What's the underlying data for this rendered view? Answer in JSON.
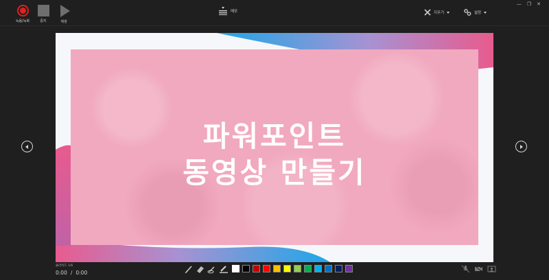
{
  "toolbar": {
    "record_label": "녹음/녹화",
    "stop_label": "중지",
    "replay_label": "재생",
    "memo_label": "메모",
    "clear_label": "지우기",
    "settings_label": "설정"
  },
  "window_controls": {
    "minimize": "—",
    "restore": "❐",
    "close": "✕"
  },
  "slide": {
    "title_line1": "파워포인트",
    "title_line2": "동영상 만들기"
  },
  "footer": {
    "slide_counter": "슬라이드 1/6",
    "time_current": "0:00",
    "time_separator": "/",
    "time_total": "0:00"
  },
  "colors": {
    "record_red": "#e02020",
    "accent_blue": "#1ea7e8",
    "accent_pink": "#e85b8e",
    "photo_pink": "#f1a9bf",
    "swatches": [
      "#ffffff",
      "#000000",
      "#c00000",
      "#ff0000",
      "#ffc000",
      "#ffff00",
      "#92d050",
      "#00b050",
      "#00b0f0",
      "#0070c0",
      "#002060",
      "#7030a0"
    ]
  },
  "icons": {
    "record": "record-icon",
    "stop": "stop-icon",
    "replay": "play-icon",
    "memo": "memo-icon",
    "clear": "eraser-x-icon",
    "settings": "settings-icon",
    "prev": "prev-arrow-icon",
    "next": "next-arrow-icon",
    "pen": "pen-icon",
    "eraser": "eraser-icon",
    "laser": "laser-pointer-icon",
    "highlighter": "highlighter-icon",
    "mic": "microphone-icon",
    "camera": "camera-icon",
    "camera_preview": "camera-preview-icon"
  }
}
